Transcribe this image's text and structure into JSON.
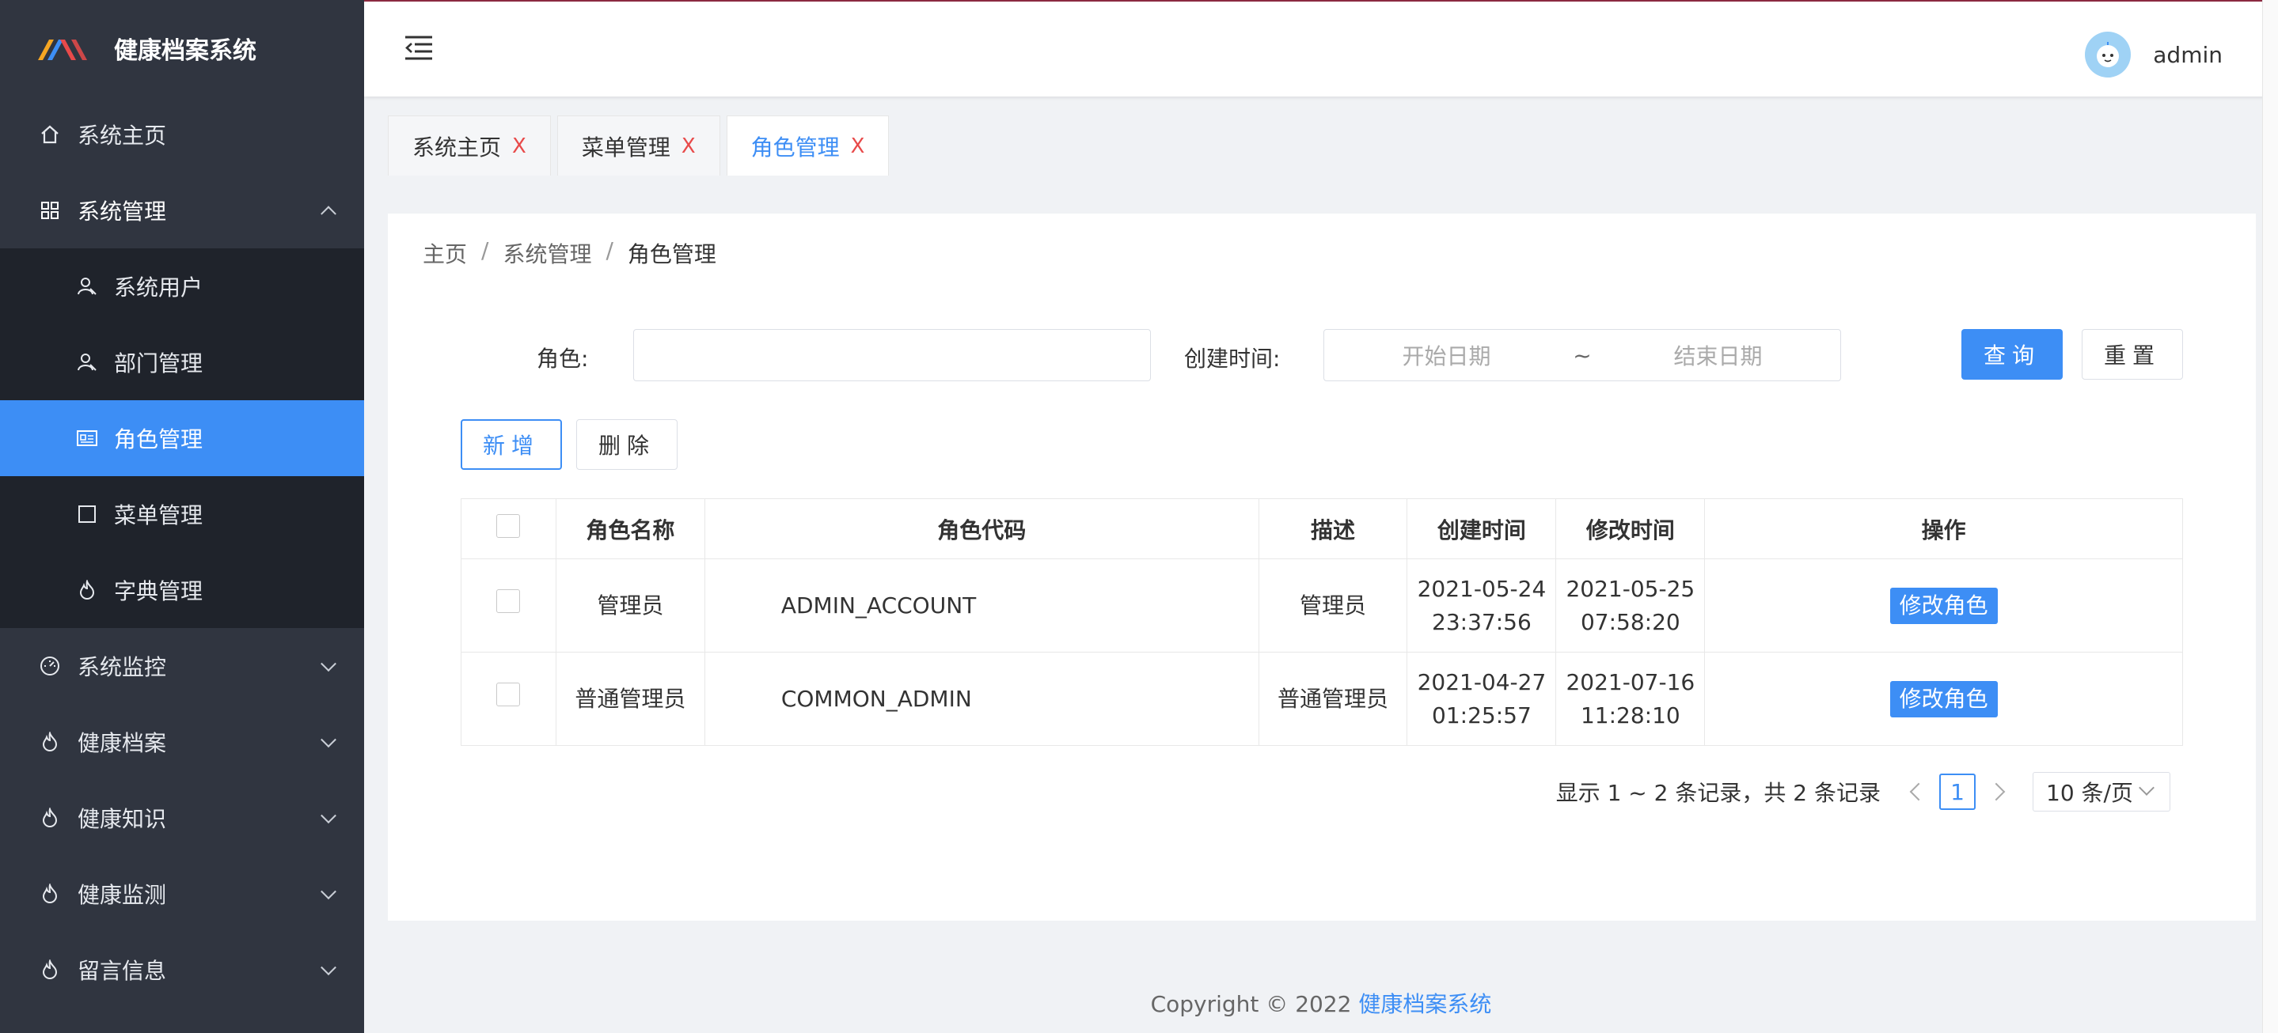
{
  "app": {
    "title": "健康档案系统"
  },
  "sidebar": {
    "items": [
      {
        "label": "系统主页",
        "icon": "home-icon"
      },
      {
        "label": "系统管理",
        "icon": "grid-icon",
        "expanded": true,
        "children": [
          {
            "label": "系统用户",
            "icon": "user-icon"
          },
          {
            "label": "部门管理",
            "icon": "user-icon"
          },
          {
            "label": "角色管理",
            "icon": "id-card-icon",
            "active": true
          },
          {
            "label": "菜单管理",
            "icon": "square-icon"
          },
          {
            "label": "字典管理",
            "icon": "flame-icon"
          }
        ]
      },
      {
        "label": "系统监控",
        "icon": "dashboard-icon"
      },
      {
        "label": "健康档案",
        "icon": "flame-icon"
      },
      {
        "label": "健康知识",
        "icon": "flame-icon"
      },
      {
        "label": "健康监测",
        "icon": "flame-icon"
      },
      {
        "label": "留言信息",
        "icon": "flame-icon"
      }
    ]
  },
  "header": {
    "username": "admin"
  },
  "tabs": [
    {
      "label": "系统主页",
      "close": "X"
    },
    {
      "label": "菜单管理",
      "close": "X"
    },
    {
      "label": "角色管理",
      "close": "X",
      "active": true
    }
  ],
  "breadcrumb": {
    "home": "主页",
    "sep": "/",
    "parent": "系统管理",
    "current": "角色管理"
  },
  "search": {
    "role_label": "角色:",
    "role_value": "",
    "created_label": "创建时间:",
    "start_placeholder": "开始日期",
    "range_sep": "~",
    "end_placeholder": "结束日期",
    "query_label": "查询",
    "reset_label": "重置"
  },
  "actions": {
    "add_label": "新增",
    "delete_label": "删除"
  },
  "table": {
    "columns": [
      "角色名称",
      "角色代码",
      "描述",
      "创建时间",
      "修改时间",
      "操作"
    ],
    "rows": [
      {
        "name": "管理员",
        "code": "ADMIN_ACCOUNT",
        "desc": "管理员",
        "created": "2021-05-24 23:37:56",
        "modified": "2021-05-25 07:58:20",
        "action": "修改角色"
      },
      {
        "name": "普通管理员",
        "code": "COMMON_ADMIN",
        "desc": "普通管理员",
        "created": "2021-04-27 01:25:57",
        "modified": "2021-07-16 11:28:10",
        "action": "修改角色"
      }
    ]
  },
  "pagination": {
    "summary": "显示 1 ~ 2 条记录，共 2 条记录",
    "current_page": "1",
    "page_size": "10 条/页"
  },
  "footer": {
    "copyright": "Copyright © 2022 ",
    "brand": "健康档案系统"
  },
  "colors": {
    "sidebar_bg": "#303540",
    "submenu_bg": "#1f232b",
    "accent": "#3d8ef5",
    "close_x": "#e84a4a"
  }
}
